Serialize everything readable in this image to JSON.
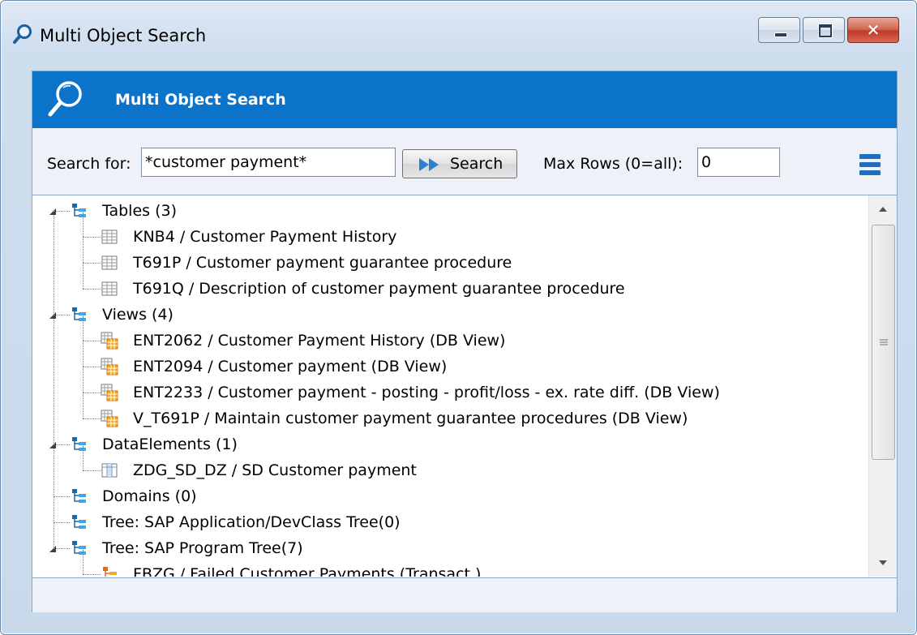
{
  "window": {
    "title": "Multi Object Search"
  },
  "banner": {
    "title": "Multi Object Search"
  },
  "toolbar": {
    "search_label": "Search for:",
    "search_value": "*customer payment*",
    "search_button": "Search",
    "maxrows_label": "Max Rows (0=all):",
    "maxrows_value": "0"
  },
  "tree": {
    "groups": [
      {
        "label": "Tables (3)",
        "expanded": true,
        "items": [
          {
            "label": "KNB4 / Customer Payment History",
            "icon": "table-icon"
          },
          {
            "label": "T691P / Customer payment guarantee procedure",
            "icon": "table-icon"
          },
          {
            "label": "T691Q / Description of customer payment guarantee procedure",
            "icon": "table-icon"
          }
        ]
      },
      {
        "label": "Views (4)",
        "expanded": true,
        "items": [
          {
            "label": "ENT2062 / Customer Payment History (DB View)",
            "icon": "view-icon"
          },
          {
            "label": "ENT2094 / Customer payment (DB View)",
            "icon": "view-icon"
          },
          {
            "label": "ENT2233 / Customer payment - posting - profit/loss - ex. rate diff. (DB View)",
            "icon": "view-icon"
          },
          {
            "label": "V_T691P / Maintain customer payment guarantee procedures (DB View)",
            "icon": "view-icon"
          }
        ]
      },
      {
        "label": "DataElements (1)",
        "expanded": true,
        "items": [
          {
            "label": "ZDG_SD_DZ / SD Customer payment",
            "icon": "data-element-icon"
          }
        ]
      },
      {
        "label": "Domains (0)",
        "expanded": false,
        "items": []
      },
      {
        "label": "Tree: SAP Application/DevClass Tree(0)",
        "expanded": false,
        "items": []
      },
      {
        "label": "Tree: SAP Program Tree(7)",
        "expanded": true,
        "items": [
          {
            "label": "FBZG / Failed Customer Payments (Transact.)",
            "icon": "transaction-icon"
          }
        ]
      }
    ]
  },
  "colors": {
    "banner": "#0b73c9",
    "accent": "#1f6fc0",
    "close": "#c0392b"
  }
}
